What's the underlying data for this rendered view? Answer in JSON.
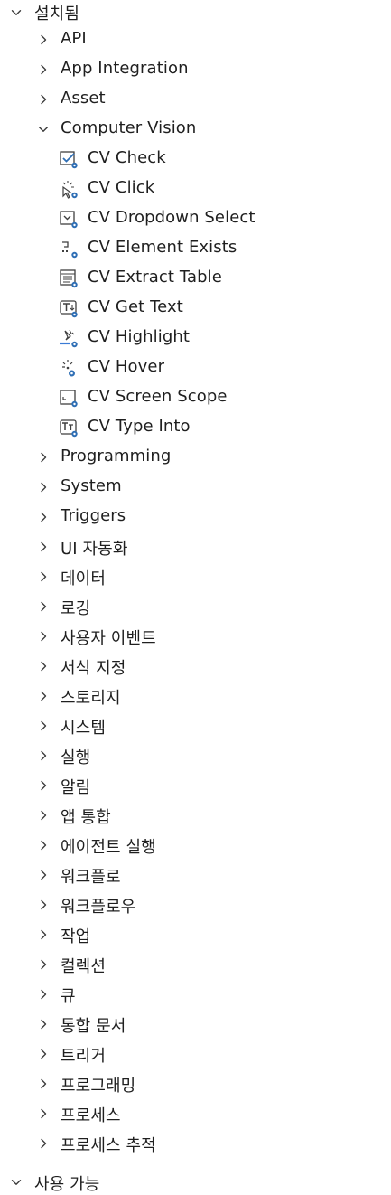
{
  "tree": {
    "root_label": "설치됨",
    "categories_before": [
      {
        "label": "API"
      },
      {
        "label": "App Integration"
      },
      {
        "label": "Asset"
      }
    ],
    "computer_vision": {
      "label": "Computer Vision",
      "children": [
        {
          "label": "CV Check",
          "icon": "cv-check-icon"
        },
        {
          "label": "CV Click",
          "icon": "cv-click-icon"
        },
        {
          "label": "CV Dropdown Select",
          "icon": "cv-dropdown-select-icon"
        },
        {
          "label": "CV Element Exists",
          "icon": "cv-element-exists-icon"
        },
        {
          "label": "CV Extract Table",
          "icon": "cv-extract-table-icon"
        },
        {
          "label": "CV Get Text",
          "icon": "cv-get-text-icon"
        },
        {
          "label": "CV Highlight",
          "icon": "cv-highlight-icon"
        },
        {
          "label": "CV Hover",
          "icon": "cv-hover-icon"
        },
        {
          "label": "CV Screen Scope",
          "icon": "cv-screen-scope-icon"
        },
        {
          "label": "CV Type Into",
          "icon": "cv-type-into-icon"
        }
      ]
    },
    "categories_after": [
      {
        "label": "Programming"
      },
      {
        "label": "System"
      },
      {
        "label": "Triggers"
      },
      {
        "label": "UI 자동화"
      },
      {
        "label": "데이터"
      },
      {
        "label": "로깅"
      },
      {
        "label": "사용자 이벤트"
      },
      {
        "label": "서식 지정"
      },
      {
        "label": "스토리지"
      },
      {
        "label": "시스템"
      },
      {
        "label": "실행"
      },
      {
        "label": "알림"
      },
      {
        "label": "앱 통합"
      },
      {
        "label": "에이전트 실행"
      },
      {
        "label": "워크플로"
      },
      {
        "label": "워크플로우"
      },
      {
        "label": "작업"
      },
      {
        "label": "컬렉션"
      },
      {
        "label": "큐"
      },
      {
        "label": "통합 문서"
      },
      {
        "label": "트리거"
      },
      {
        "label": "프로그래밍"
      },
      {
        "label": "프로세스"
      },
      {
        "label": "프로세스 추적"
      }
    ],
    "next_root_label": "사용 가능"
  },
  "colors": {
    "text": "#1f1f1f",
    "chevron": "#3c3c3c",
    "icon_stroke": "#3f3f3f",
    "icon_accent": "#2f6fb5",
    "highlight_accent": "#3a7bd5"
  }
}
